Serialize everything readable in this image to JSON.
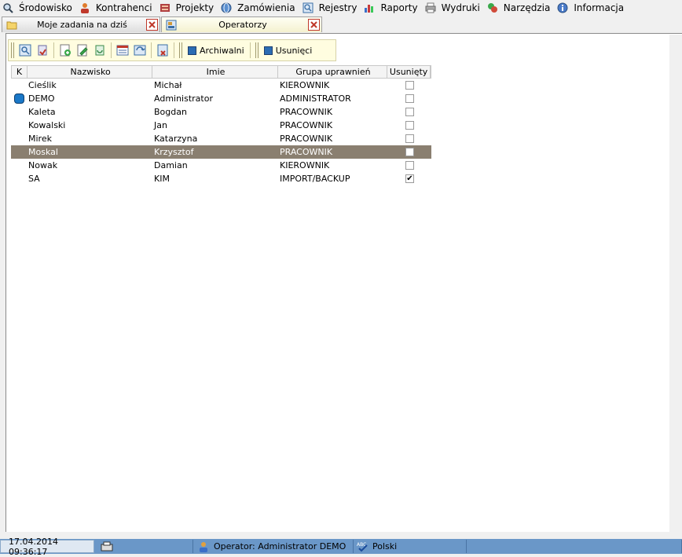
{
  "menu": [
    {
      "label": "Środowisko",
      "icon": "magnifier-icon"
    },
    {
      "label": "Kontrahenci",
      "icon": "person-icon"
    },
    {
      "label": "Projekty",
      "icon": "projects-icon"
    },
    {
      "label": "Zamówienia",
      "icon": "globe-icon"
    },
    {
      "label": "Rejestry",
      "icon": "registry-icon"
    },
    {
      "label": "Raporty",
      "icon": "bar-chart-icon"
    },
    {
      "label": "Wydruki",
      "icon": "printer-icon"
    },
    {
      "label": "Narzędzia",
      "icon": "tools-icon"
    },
    {
      "label": "Informacja",
      "icon": "info-icon"
    }
  ],
  "tabs": [
    {
      "label": "Moje zadania na dziś",
      "icon": "folder-icon"
    },
    {
      "label": "Operatorzy",
      "icon": "operators-icon"
    }
  ],
  "toolbar": {
    "archiwalni_label": "Archiwalni",
    "usunieci_label": "Usunięci"
  },
  "grid": {
    "headers": {
      "k": "K",
      "nazwisko": "Nazwisko",
      "imie": "Imie",
      "grupa": "Grupa uprawnień",
      "usuniety": "Usunięty"
    },
    "rows": [
      {
        "nazwisko": "Cieślik",
        "imie": "Michał",
        "grupa": "KIEROWNIK",
        "usuniety": false,
        "k": false,
        "selected": false
      },
      {
        "nazwisko": "DEMO",
        "imie": "Administrator",
        "grupa": "ADMINISTRATOR",
        "usuniety": false,
        "k": true,
        "selected": false
      },
      {
        "nazwisko": "Kaleta",
        "imie": "Bogdan",
        "grupa": "PRACOWNIK",
        "usuniety": false,
        "k": false,
        "selected": false
      },
      {
        "nazwisko": "Kowalski",
        "imie": "Jan",
        "grupa": "PRACOWNIK",
        "usuniety": false,
        "k": false,
        "selected": false
      },
      {
        "nazwisko": "Mirek",
        "imie": "Katarzyna",
        "grupa": "PRACOWNIK",
        "usuniety": false,
        "k": false,
        "selected": false
      },
      {
        "nazwisko": "Moskal",
        "imie": "Krzysztof",
        "grupa": "PRACOWNIK",
        "usuniety": false,
        "k": false,
        "selected": true
      },
      {
        "nazwisko": "Nowak",
        "imie": "Damian",
        "grupa": "KIEROWNIK",
        "usuniety": false,
        "k": false,
        "selected": false
      },
      {
        "nazwisko": "SA",
        "imie": "KIM",
        "grupa": "IMPORT/BACKUP",
        "usuniety": true,
        "k": false,
        "selected": false
      }
    ]
  },
  "status": {
    "datetime": "17.04.2014 09:36:17",
    "operator": "Operator: Administrator DEMO",
    "language": "Polski"
  },
  "colors": {
    "selected_row": "#8a7f70",
    "status_bar": "#6a97c8",
    "toolbar_bg": "#fffde0"
  }
}
